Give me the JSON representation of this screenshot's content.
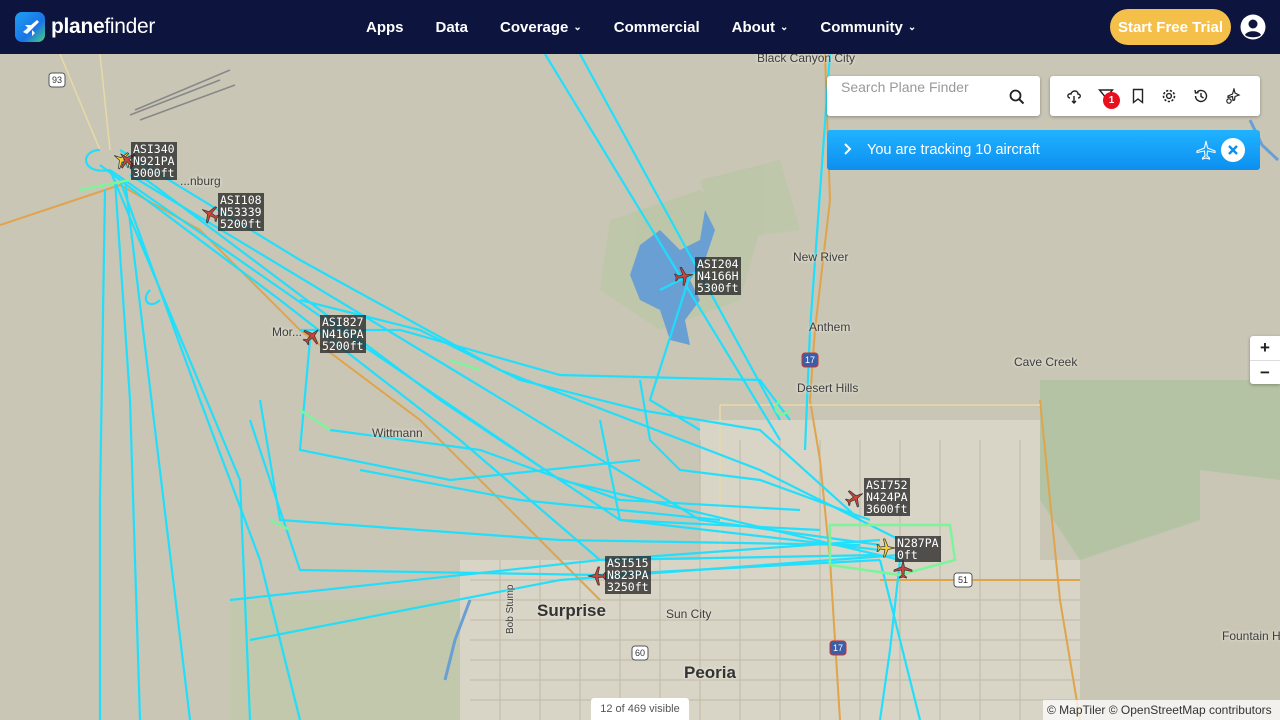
{
  "header": {
    "logo_bold": "plane",
    "logo_regular": "finder",
    "nav": [
      {
        "label": "Apps",
        "dropdown": false
      },
      {
        "label": "Data",
        "dropdown": false
      },
      {
        "label": "Coverage",
        "dropdown": true
      },
      {
        "label": "Commercial",
        "dropdown": false
      },
      {
        "label": "About",
        "dropdown": true
      },
      {
        "label": "Community",
        "dropdown": true
      }
    ],
    "cta_label": "Start Free Trial"
  },
  "search": {
    "placeholder": "Search Plane Finder"
  },
  "toolbar": {
    "tools": [
      "weather-icon",
      "filter-icon",
      "bookmark-icon",
      "settings-icon",
      "history-icon",
      "playback-icon"
    ],
    "filter_badge": "1"
  },
  "tracking": {
    "message": "You are tracking 10 aircraft"
  },
  "zoom": {
    "in": "+",
    "out": "−"
  },
  "status": {
    "visible": "12 of 469 visible"
  },
  "attribution": "© MapTiler © OpenStreetMap contributors",
  "places": {
    "black_canyon": "Black Canyon City",
    "wickenburg": "...nburg",
    "new_river": "New River",
    "anthem": "Anthem",
    "desert_hills": "Desert Hills",
    "cave_creek": "Cave Creek",
    "morristown": "Mor...",
    "wittmann": "Wittmann",
    "surprise": "Surprise",
    "sun_city": "Sun City",
    "peoria": "Peoria",
    "fountain": "Fountain H...",
    "bob_stump": "Bob Stump"
  },
  "shields": [
    "93",
    "17",
    "51",
    "17",
    "60"
  ],
  "aircraft": [
    {
      "callsign": "ASI340",
      "reg": "N921PA",
      "alt": "3000ft"
    },
    {
      "callsign": "ASI108",
      "reg": "N53339",
      "alt": "5200ft"
    },
    {
      "callsign": "ASI204",
      "reg": "N4166H",
      "alt": "5300ft"
    },
    {
      "callsign": "ASI827",
      "reg": "N416PA",
      "alt": "5200ft"
    },
    {
      "callsign": "ASI752",
      "reg": "N424PA",
      "alt": "3600ft"
    },
    {
      "callsign": "",
      "reg": "N287PA",
      "alt": "0ft"
    },
    {
      "callsign": "ASI515",
      "reg": "N823PA",
      "alt": "3250ft"
    }
  ],
  "colors": {
    "header": "#0d143d",
    "cta": "#f5c04a",
    "track": "#19e0ff",
    "track_ground": "#7cf59a",
    "tracking_bar": "#0d8ff0",
    "badge": "#e8101c"
  }
}
